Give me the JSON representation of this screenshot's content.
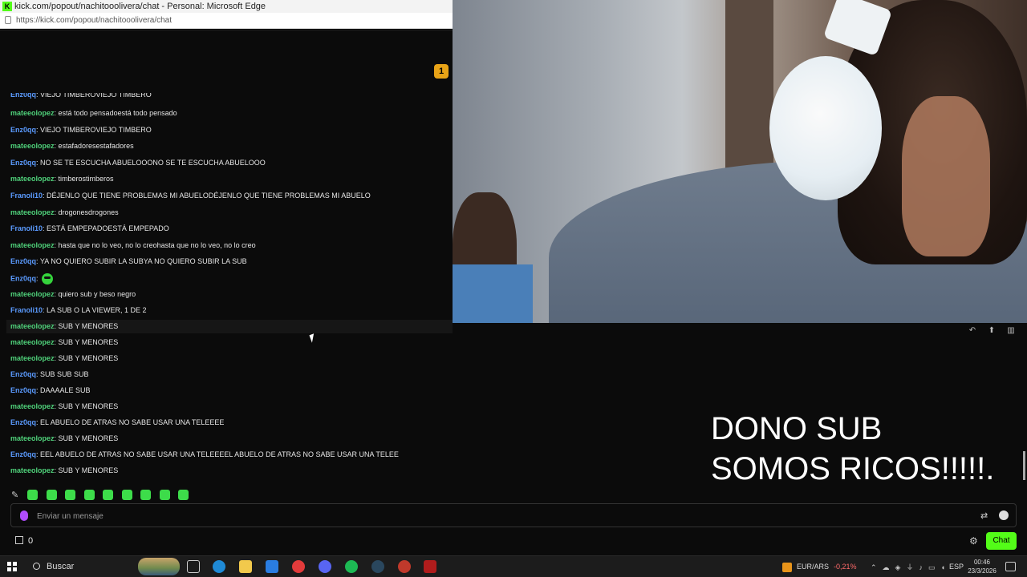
{
  "window": {
    "title": "kick.com/popout/nachitooolivera/chat - Personal: Microsoft Edge",
    "url": "https://kick.com/popout/nachitooolivera/chat",
    "app_icon": "K"
  },
  "chat": {
    "badge_count": "1",
    "messages": [
      {
        "user": "Enz0qq",
        "text": ": VIEJO TIMBEROVIEJO TIMBERO",
        "color": "blue"
      },
      {
        "user": "mateeolopez",
        "text": ": está todo pensadoestá todo pensado",
        "color": "green"
      },
      {
        "user": "Enz0qq",
        "text": ": VIEJO TIMBEROVIEJO TIMBERO",
        "color": "blue"
      },
      {
        "user": "mateeolopez",
        "text": ": estafadoresestafadores",
        "color": "green"
      },
      {
        "user": "Enz0qq",
        "text": ": NO SE TE ESCUCHA ABUELOOONO SE TE ESCUCHA ABUELOOO",
        "color": "blue"
      },
      {
        "user": "mateeolopez",
        "text": ": timberostimberos",
        "color": "green"
      },
      {
        "user": "Franoli10",
        "text": ": DÉJENLO QUE TIENE PROBLEMAS MI ABUELODÉJENLO QUE TIENE PROBLEMAS MI ABUELO",
        "color": "blue"
      },
      {
        "user": "mateeolopez",
        "text": ": drogonesdrogones",
        "color": "green"
      },
      {
        "user": "Franoli10",
        "text": ": ESTÁ EMPEPADOESTÁ EMPEPADO",
        "color": "blue"
      },
      {
        "user": "mateeolopez",
        "text": ": hasta que no lo veo, no lo creohasta que no lo veo, no lo creo",
        "color": "green"
      },
      {
        "user": "Enz0qq",
        "text": ": YA NO QUIERO SUBIR LA SUBYA NO QUIERO SUBIR LA SUB",
        "color": "blue"
      },
      {
        "user": "Enz0qq",
        "text": ":",
        "color": "blue",
        "emote": true
      },
      {
        "user": "mateeolopez",
        "text": ": quiero sub y beso negro",
        "color": "green"
      },
      {
        "user": "Franoli10",
        "text": ": LA SUB O LA VIEWER, 1 DE 2",
        "color": "blue"
      },
      {
        "user": "mateeolopez",
        "text": ": SUB Y MENORES",
        "color": "green"
      },
      {
        "user": "mateeolopez",
        "text": ": SUB Y MENORES",
        "color": "green"
      },
      {
        "user": "mateeolopez",
        "text": ": SUB Y MENORES",
        "color": "green"
      },
      {
        "user": "Enz0qq",
        "text": ": SUB SUB SUB",
        "color": "blue"
      },
      {
        "user": "Enz0qq",
        "text": ": DAAAALE SUB",
        "color": "blue"
      },
      {
        "user": "mateeolopez",
        "text": ": SUB Y MENORES",
        "color": "green"
      },
      {
        "user": "Enz0qq",
        "text": ": EL ABUELO DE ATRAS NO SABE USAR UNA TELEEEE",
        "color": "blue"
      },
      {
        "user": "mateeolopez",
        "text": ": SUB Y MENORES",
        "color": "green"
      },
      {
        "user": "Enz0qq",
        "text": ": EEL ABUELO DE ATRAS NO SABE USAR UNA TELEEEEL ABUELO DE ATRAS NO SABE USAR UNA TELEE",
        "color": "blue"
      },
      {
        "user": "mateeolopez",
        "text": ": SUB Y MENORES",
        "color": "green"
      }
    ],
    "input_placeholder": "Enviar un mensaje",
    "points": "0",
    "chat_button": "Chat"
  },
  "overlay": {
    "line1": "DONO SUB",
    "line2": "SOMOS RICOS!!!!!."
  },
  "taskbar": {
    "search_label": "Buscar",
    "currency_pair": "EUR/ARS",
    "currency_change": "-0,21%",
    "language": "ESP",
    "time": "00:46",
    "date": "23/3/2026"
  },
  "colors": {
    "kick_green": "#53fc18",
    "user_green": "#4fd17a",
    "user_blue": "#5b9bff"
  }
}
